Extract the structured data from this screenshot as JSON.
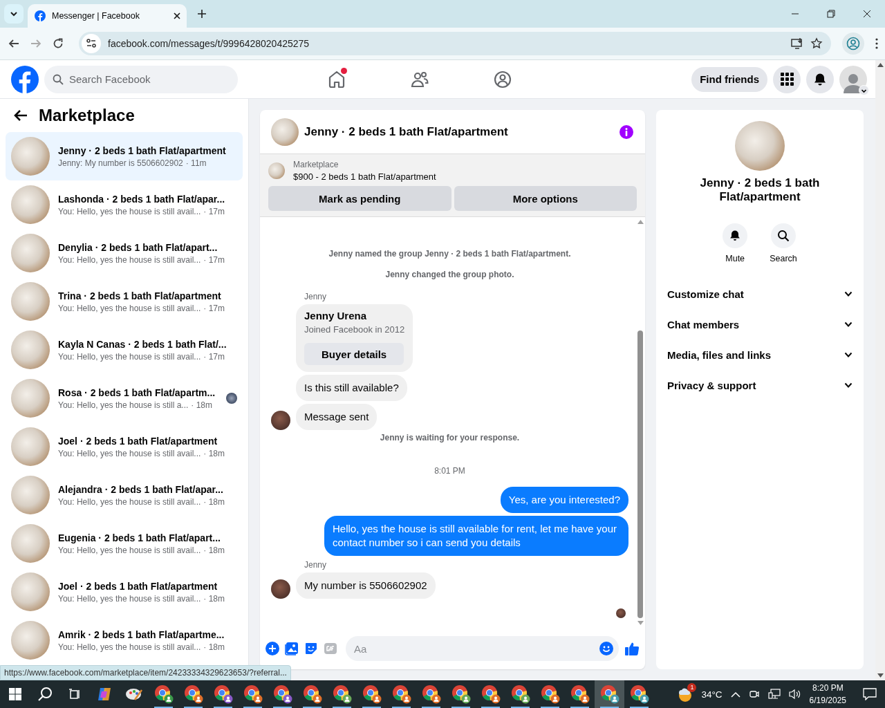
{
  "browser": {
    "tab_title": "Messenger | Facebook",
    "url": "facebook.com/messages/t/9996428020425275",
    "status_url": "https://www.facebook.com/marketplace/item/24233334329623653/?referral..."
  },
  "header": {
    "search": {
      "placeholder": "Search Facebook"
    },
    "nav": [
      {
        "kind": "home",
        "notification": true
      },
      {
        "kind": "friends",
        "notification": false
      },
      {
        "kind": "groups",
        "notification": false
      }
    ],
    "find_friends": "Find friends"
  },
  "sidebar": {
    "title": "Marketplace",
    "conversations": [
      {
        "name": "Jenny · 2 beds 1 bath Flat/apartment",
        "preview": "Jenny: My number is 5506602902",
        "time": "· 11m",
        "selected": true,
        "seen": false
      },
      {
        "name": "Lashonda · 2 beds 1 bath Flat/apar...",
        "preview": "You: Hello, yes the house is still avail...",
        "time": "· 17m",
        "selected": false,
        "seen": false
      },
      {
        "name": "Denylia · 2 beds 1 bath Flat/apart...",
        "preview": "You: Hello, yes the house is still avail...",
        "time": "· 17m",
        "selected": false,
        "seen": false
      },
      {
        "name": "Trina · 2 beds 1 bath Flat/apartment",
        "preview": "You: Hello, yes the house is still avail...",
        "time": "· 17m",
        "selected": false,
        "seen": false
      },
      {
        "name": "Kayla N Canas · 2 beds 1 bath Flat/...",
        "preview": "You: Hello, yes the house is still avail...",
        "time": "· 17m",
        "selected": false,
        "seen": false
      },
      {
        "name": "Rosa · 2 beds 1 bath Flat/apartm...",
        "preview": "You: Hello, yes the house is still a...",
        "time": "· 18m",
        "selected": false,
        "seen": true
      },
      {
        "name": "Joel · 2 beds 1 bath Flat/apartment",
        "preview": "You: Hello, yes the house is still avail...",
        "time": "· 18m",
        "selected": false,
        "seen": false
      },
      {
        "name": "Alejandra · 2 beds 1 bath Flat/apar...",
        "preview": "You: Hello, yes the house is still avail...",
        "time": "· 18m",
        "selected": false,
        "seen": false
      },
      {
        "name": "Eugenia · 2 beds 1 bath Flat/apart...",
        "preview": "You: Hello, yes the house is still avail...",
        "time": "· 18m",
        "selected": false,
        "seen": false
      },
      {
        "name": "Joel · 2 beds 1 bath Flat/apartment",
        "preview": "You: Hello, yes the house is still avail...",
        "time": "· 18m",
        "selected": false,
        "seen": false
      },
      {
        "name": "Amrik · 2 beds 1 bath Flat/apartme...",
        "preview": "You: Hello, yes the house is still avail...",
        "time": "· 18m",
        "selected": false,
        "seen": false
      }
    ]
  },
  "chat": {
    "title": "Jenny · 2 beds 1 bath Flat/apartment",
    "listing": {
      "label": "Marketplace",
      "title": "$900 - 2 beds 1 bath Flat/apartment",
      "buttons": [
        "Mark as pending",
        "More options"
      ]
    },
    "messages": [
      {
        "kind": "system",
        "text": "Jenny named the group Jenny · 2 beds 1 bath Flat/apartment."
      },
      {
        "kind": "system",
        "text": "Jenny changed the group photo."
      },
      {
        "kind": "sender",
        "text": "Jenny"
      },
      {
        "kind": "card",
        "title": "Jenny Urena",
        "subtitle": "Joined Facebook in 2012",
        "button": "Buyer details"
      },
      {
        "kind": "incoming",
        "text": "Is this still available?",
        "avatar": false
      },
      {
        "kind": "incoming",
        "text": "Message sent",
        "avatar": true
      },
      {
        "kind": "system",
        "text": "Jenny is waiting for your response."
      },
      {
        "kind": "time",
        "text": "8:01 PM"
      },
      {
        "kind": "outgoing",
        "text": "Yes, are you interested?"
      },
      {
        "kind": "outgoing",
        "text": "Hello, yes the house is still available for rent, let me have your contact number so i can send you details"
      },
      {
        "kind": "sender",
        "text": "Jenny"
      },
      {
        "kind": "incoming",
        "text": "My number is 5506602902",
        "avatar": true
      },
      {
        "kind": "seen"
      }
    ],
    "composer": {
      "placeholder": "Aa"
    }
  },
  "details": {
    "name": "Jenny · 2 beds 1 bath Flat/apartment",
    "actions": [
      {
        "kind": "mute",
        "label": "Mute"
      },
      {
        "kind": "search",
        "label": "Search"
      }
    ],
    "sections": [
      {
        "label": "Customize chat",
        "expanded": false
      },
      {
        "label": "Chat members",
        "expanded": false
      },
      {
        "label": "Media, files and links",
        "expanded": false
      },
      {
        "label": "Privacy & support",
        "expanded": false
      }
    ]
  },
  "taskbar": {
    "apps": [
      {
        "kind": "copilot",
        "selected": false
      },
      {
        "kind": "paint",
        "selected": false
      },
      {
        "kind": "chrome",
        "color": "#3c9a4a",
        "selected": false
      },
      {
        "kind": "chrome",
        "color": "#e0702a",
        "selected": false
      },
      {
        "kind": "chrome",
        "color": "#8a5ac8",
        "selected": false
      },
      {
        "kind": "chrome",
        "color": "#e0702a",
        "selected": false
      },
      {
        "kind": "chrome",
        "color": "#8a5ac8",
        "selected": false
      },
      {
        "kind": "chrome",
        "color": "#e0702a",
        "selected": false
      },
      {
        "kind": "chrome",
        "color": "#6aaa5a",
        "selected": false
      },
      {
        "kind": "chrome",
        "color": "#e0702a",
        "selected": false
      },
      {
        "kind": "chrome",
        "color": "#e0702a",
        "selected": false
      },
      {
        "kind": "chrome",
        "color": "#e0702a",
        "selected": false
      },
      {
        "kind": "chrome",
        "color": "#6aaa5a",
        "selected": false
      },
      {
        "kind": "chrome",
        "color": "#e0702a",
        "selected": false
      },
      {
        "kind": "chrome",
        "color": "#6aaa5a",
        "selected": false
      },
      {
        "kind": "chrome",
        "color": "#e0702a",
        "selected": false
      },
      {
        "kind": "chrome",
        "color": "#e0702a",
        "selected": false
      },
      {
        "kind": "chrome",
        "color": "#4aa0b0",
        "selected": true
      },
      {
        "kind": "chrome",
        "color": "#4aa0b0",
        "selected": false
      }
    ],
    "weather": {
      "badge": "1",
      "temperature": "34°C"
    },
    "time": "8:20 PM",
    "date": "6/19/2025"
  }
}
